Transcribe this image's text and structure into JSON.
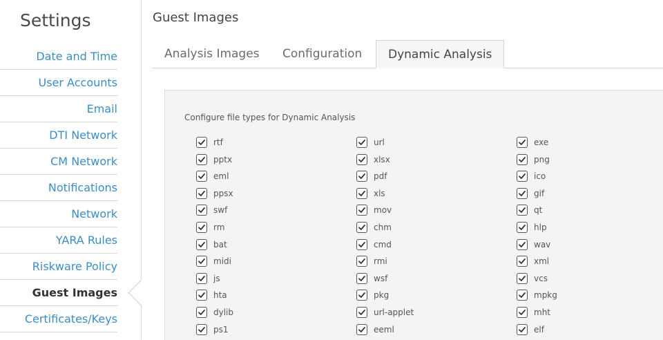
{
  "sidebar": {
    "title": "Settings",
    "items": [
      {
        "label": "Date and Time",
        "active": false
      },
      {
        "label": "User Accounts",
        "active": false
      },
      {
        "label": "Email",
        "active": false
      },
      {
        "label": "DTI Network",
        "active": false
      },
      {
        "label": "CM Network",
        "active": false
      },
      {
        "label": "Notifications",
        "active": false
      },
      {
        "label": "Network",
        "active": false
      },
      {
        "label": "YARA Rules",
        "active": false
      },
      {
        "label": "Riskware Policy",
        "active": false
      },
      {
        "label": "Guest Images",
        "active": true
      },
      {
        "label": "Certificates/Keys",
        "active": false
      }
    ]
  },
  "main": {
    "title": "Guest Images",
    "tabs": [
      {
        "label": "Analysis Images",
        "active": false
      },
      {
        "label": "Configuration",
        "active": false
      },
      {
        "label": "Dynamic Analysis",
        "active": true
      }
    ],
    "panel": {
      "heading": "Configure file types for Dynamic Analysis",
      "columns": [
        [
          {
            "label": "rtf",
            "checked": true
          },
          {
            "label": "pptx",
            "checked": true
          },
          {
            "label": "eml",
            "checked": true
          },
          {
            "label": "ppsx",
            "checked": true
          },
          {
            "label": "swf",
            "checked": true
          },
          {
            "label": "rm",
            "checked": true
          },
          {
            "label": "bat",
            "checked": true
          },
          {
            "label": "midi",
            "checked": true
          },
          {
            "label": "js",
            "checked": true
          },
          {
            "label": "hta",
            "checked": true
          },
          {
            "label": "dylib",
            "checked": true
          },
          {
            "label": "ps1",
            "checked": true
          }
        ],
        [
          {
            "label": "url",
            "checked": true
          },
          {
            "label": "xlsx",
            "checked": true
          },
          {
            "label": "pdf",
            "checked": true
          },
          {
            "label": "xls",
            "checked": true
          },
          {
            "label": "mov",
            "checked": true
          },
          {
            "label": "chm",
            "checked": true
          },
          {
            "label": "cmd",
            "checked": true
          },
          {
            "label": "rmi",
            "checked": true
          },
          {
            "label": "wsf",
            "checked": true
          },
          {
            "label": "pkg",
            "checked": true
          },
          {
            "label": "url-applet",
            "checked": true
          },
          {
            "label": "eeml",
            "checked": true
          }
        ],
        [
          {
            "label": "exe",
            "checked": true
          },
          {
            "label": "png",
            "checked": true
          },
          {
            "label": "ico",
            "checked": true
          },
          {
            "label": "gif",
            "checked": true
          },
          {
            "label": "qt",
            "checked": true
          },
          {
            "label": "hlp",
            "checked": true
          },
          {
            "label": "wav",
            "checked": true
          },
          {
            "label": "xml",
            "checked": true
          },
          {
            "label": "vcs",
            "checked": true
          },
          {
            "label": "mpkg",
            "checked": true
          },
          {
            "label": "mht",
            "checked": true
          },
          {
            "label": "elf",
            "checked": true
          }
        ]
      ]
    }
  },
  "icons": {
    "checkbox": "check-icon",
    "active_indicator": "chevron-left-icon"
  },
  "colors": {
    "link": "#3b8ec4",
    "panel_bg": "#f4f4f4",
    "border": "#d4d4d4"
  }
}
